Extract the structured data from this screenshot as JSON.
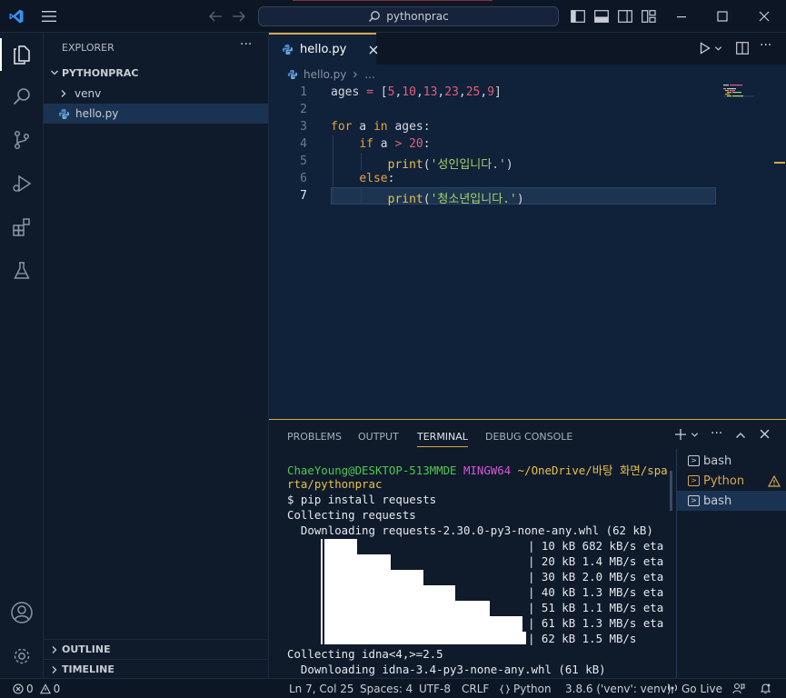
{
  "titlebar": {
    "search_text": "pythonprac"
  },
  "explorer": {
    "title": "EXPLORER",
    "more": "···",
    "folder": "PYTHONPRAC",
    "items": [
      {
        "label": "venv"
      },
      {
        "label": "hello.py"
      }
    ],
    "outline": "OUTLINE",
    "timeline": "TIMELINE"
  },
  "editor": {
    "tab_label": "hello.py",
    "breadcrumb_file": "hello.py",
    "breadcrumb_more": "...",
    "line_numbers": [
      "1",
      "2",
      "3",
      "4",
      "5",
      "6",
      "7"
    ],
    "lines": {
      "l1": {
        "a": "ages ",
        "b": "=",
        "c": " [",
        "n1": "5",
        "n2": "10",
        "n3": "13",
        "n4": "23",
        "n5": "25",
        "n6": "9",
        "close": "]"
      },
      "l3": {
        "kw1": "for",
        "mid": " a ",
        "kw2": "in",
        "rest": " ages:"
      },
      "l4": {
        "kw": "if",
        "mid": " a ",
        "op": ">",
        "sp": " ",
        "num": "20",
        "colon": ":"
      },
      "l5": {
        "fn": "print",
        "open": "(",
        "str": "'성인입니다.'",
        "close": ")"
      },
      "l6": {
        "kw": "else",
        "colon": ":"
      },
      "l7": {
        "fn": "print",
        "open": "(",
        "str": "'청소년입니다.'",
        "close": ")"
      }
    }
  },
  "panel": {
    "tabs": [
      "PROBLEMS",
      "OUTPUT",
      "TERMINAL",
      "DEBUG CONSOLE"
    ],
    "terminal": {
      "user": "ChaeYoung@DESKTOP-513MMDE",
      "shell": "MINGW64",
      "path1": "~/OneDrive/바탕 화면/spa",
      "path2": "rta/pythonprac",
      "lines": [
        "$ pip install requests",
        "Collecting requests",
        "  Downloading requests-2.30.0-py3-none-any.whl (62 kB)"
      ],
      "progress": [
        "| 10 kB 682 kB/s eta",
        "| 20 kB 1.4 MB/s eta",
        "| 30 kB 2.0 MB/s eta",
        "| 40 kB 1.3 MB/s eta",
        "| 51 kB 1.1 MB/s eta",
        "| 61 kB 1.3 MB/s eta",
        "| 62 kB 1.5 MB/s"
      ],
      "progress_fractions": [
        0.16,
        0.33,
        0.49,
        0.65,
        0.82,
        0.98,
        1.0
      ],
      "tail": [
        "Collecting idna<4,>=2.5",
        "  Downloading idna-3.4-py3-none-any.whl (61 kB)"
      ]
    },
    "terminal_list": [
      {
        "label": "bash"
      },
      {
        "label": "Python"
      },
      {
        "label": "bash"
      }
    ]
  },
  "statusbar": {
    "errors": "0",
    "warnings": "0",
    "position": "Ln 7, Col 25",
    "spaces": "Spaces: 4",
    "encoding": "UTF-8",
    "eol": "CRLF",
    "language": "Python",
    "interpreter": "3.8.6 ('venv': venv)",
    "golive": "Go Live"
  },
  "colors": {
    "accent": "#d6a84a",
    "vscode_blue": "#3c8ff0",
    "prompt_green": "#4ec94e",
    "mingw_magenta": "#d558d5",
    "path_yellow": "#e8c14a"
  }
}
